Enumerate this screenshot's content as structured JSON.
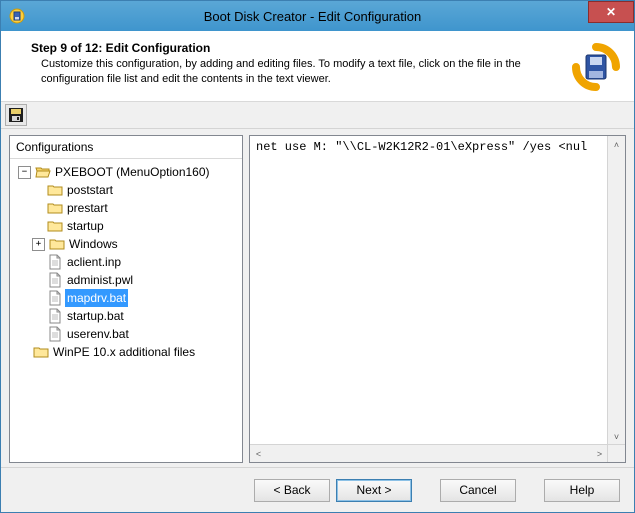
{
  "titlebar": {
    "title": "Boot Disk Creator - Edit Configuration"
  },
  "header": {
    "step_title": "Step 9 of 12: Edit Configuration",
    "step_desc": "Customize this configuration, by adding and editing files.  To modify a text file, click on the file in the configuration file list and edit the contents in the text viewer."
  },
  "tree": {
    "header": "Configurations",
    "root": {
      "label": "PXEBOOT (MenuOption160)",
      "children": [
        {
          "label": "poststart",
          "type": "folder"
        },
        {
          "label": "prestart",
          "type": "folder"
        },
        {
          "label": "startup",
          "type": "folder"
        },
        {
          "label": "Windows",
          "type": "folder",
          "expandable": true
        },
        {
          "label": "aclient.inp",
          "type": "file"
        },
        {
          "label": "administ.pwl",
          "type": "file"
        },
        {
          "label": "mapdrv.bat",
          "type": "file",
          "selected": true
        },
        {
          "label": "startup.bat",
          "type": "file"
        },
        {
          "label": "userenv.bat",
          "type": "file"
        }
      ]
    },
    "extra_root": {
      "label": "WinPE 10.x additional files",
      "type": "folder"
    }
  },
  "editor": {
    "content": "net use M: \"\\\\CL-W2K12R2-01\\eXpress\" /yes <nul"
  },
  "buttons": {
    "back": "< Back",
    "next": "Next >",
    "cancel": "Cancel",
    "help": "Help"
  }
}
